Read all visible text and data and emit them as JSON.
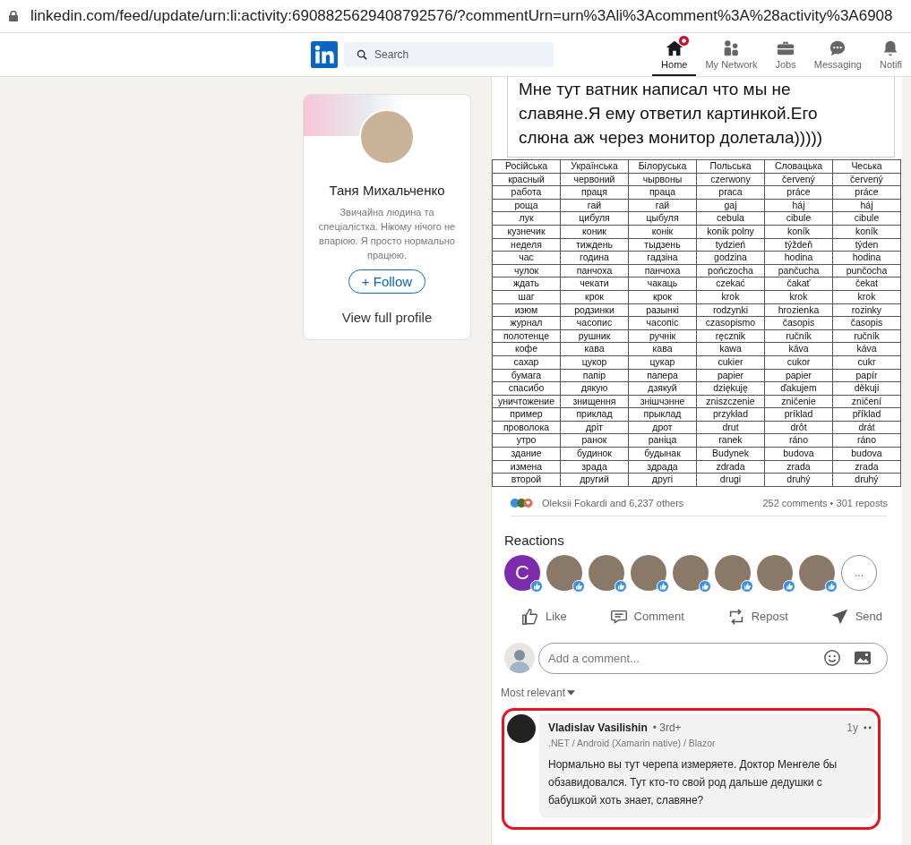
{
  "address_bar": {
    "url": "linkedin.com/feed/update/urn:li:activity:6908825629408792576/?commentUrn=urn%3Ali%3Acomment%3A%28activity%3A6908"
  },
  "nav": {
    "search": {
      "placeholder": "Search"
    },
    "items": [
      {
        "label": "Home",
        "selected": true,
        "badge": true
      },
      {
        "label": "My Network",
        "selected": false,
        "badge": false
      },
      {
        "label": "Jobs",
        "selected": false,
        "badge": false
      },
      {
        "label": "Messaging",
        "selected": false,
        "badge": false
      },
      {
        "label": "Notifi",
        "selected": false,
        "badge": false
      }
    ]
  },
  "profile_card": {
    "name": "Таня Михальченко",
    "bio": "Звичайна людина та спеціалістка. Нікому нічого не впарюю. Я просто нормально працюю.",
    "follow_button": "+ Follow",
    "view_profile": "View full profile"
  },
  "post": {
    "image": {
      "caption_lines": [
        "Мне тут ватник написал что мы не",
        "славяне.Я ему ответил картинкой.Его",
        "слюна аж через монитор долетала)))))"
      ],
      "table": {
        "columns": [
          "Російська",
          "Українська",
          "Білоруська",
          "Польська",
          "Словацька",
          "Чеська"
        ],
        "rows": [
          [
            "красный",
            "червоний",
            "чырвоны",
            "czerwony",
            "červený",
            "červený"
          ],
          [
            "работа",
            "праця",
            "праца",
            "praca",
            "práce",
            "práce"
          ],
          [
            "роща",
            "гай",
            "гай",
            "gaj",
            "háj",
            "háj"
          ],
          [
            "лук",
            "цибуля",
            "цыбуля",
            "cebula",
            "cibule",
            "cibule"
          ],
          [
            "кузнечик",
            "коник",
            "конік",
            "konik polny",
            "koník",
            "koník"
          ],
          [
            "неделя",
            "тиждень",
            "тыдзень",
            "tydzień",
            "týždeň",
            "týden"
          ],
          [
            "час",
            "година",
            "гадзіна",
            "godzina",
            "hodina",
            "hodina"
          ],
          [
            "чулок",
            "панчоха",
            "панчоха",
            "pończocha",
            "pančucha",
            "punčocha"
          ],
          [
            "ждать",
            "чекати",
            "чакаць",
            "czekać",
            "čakať",
            "čekat"
          ],
          [
            "шаг",
            "крок",
            "крок",
            "krok",
            "krok",
            "krok"
          ],
          [
            "изюм",
            "родзинки",
            "разынкі",
            "rodzynki",
            "hrozienka",
            "rozinky"
          ],
          [
            "журнал",
            "часопис",
            "часопіс",
            "czasopismo",
            "časopis",
            "časopis"
          ],
          [
            "полотенце",
            "рушник",
            "ручнік",
            "ręcznik",
            "ručník",
            "ručník"
          ],
          [
            "кофе",
            "кава",
            "кава",
            "kawa",
            "káva",
            "káva"
          ],
          [
            "сахар",
            "цукор",
            "цукар",
            "cukier",
            "cukor",
            "cukr"
          ],
          [
            "бумага",
            "папір",
            "папера",
            "papier",
            "papier",
            "papír"
          ],
          [
            "спасибо",
            "дякую",
            "дзякуй",
            "dziękuję",
            "ďakujem",
            "děkuji"
          ],
          [
            "уничтожение",
            "знищення",
            "знішчэнне",
            "zniszczenie",
            "zničenie",
            "zničení"
          ],
          [
            "пример",
            "приклад",
            "прыклад",
            "przykład",
            "príklad",
            "příklad"
          ],
          [
            "проволока",
            "дріт",
            "дрот",
            "drut",
            "drôt",
            "drát"
          ],
          [
            "утро",
            "ранок",
            "раніца",
            "ranek",
            "ráno",
            "ráno"
          ],
          [
            "здание",
            "будинок",
            "будынак",
            "Budynek",
            "budova",
            "budova"
          ],
          [
            "измена",
            "зрада",
            "здрада",
            "zdrada",
            "zrada",
            "zrada"
          ],
          [
            "второй",
            "другий",
            "другі",
            "drugi",
            "druhý",
            "druhý"
          ]
        ]
      }
    },
    "reactions_summary": "Oleksii Fokardi and 6,237 others",
    "counts": "252 comments • 301 reposts",
    "reactions_heading": "Reactions",
    "reactors": [
      {
        "kind": "letter",
        "initial": "C"
      },
      {
        "kind": "photo"
      },
      {
        "kind": "photo"
      },
      {
        "kind": "photo"
      },
      {
        "kind": "photo"
      },
      {
        "kind": "photo"
      },
      {
        "kind": "photo"
      },
      {
        "kind": "photo"
      }
    ],
    "more_reactors": "...",
    "actions": [
      {
        "kind": "like",
        "label": "Like"
      },
      {
        "kind": "comment",
        "label": "Comment"
      },
      {
        "kind": "repost",
        "label": "Repost"
      },
      {
        "kind": "send",
        "label": "Send"
      }
    ],
    "comment_input": {
      "placeholder": "Add a comment..."
    },
    "sort": "Most relevant",
    "comments": [
      {
        "author": "Vladislav Vasilishin",
        "degree": "• 3rd+",
        "headline": ".NET / Android (Xamarin native) / Blazor",
        "time": "1y",
        "text": "Нормально вы тут черепа измеряете. Доктор Менгеле бы обзавидовался. Тут кто-то свой род дальше дедушки с бабушкой хоть знает, славяне?",
        "highlighted": true
      }
    ]
  }
}
